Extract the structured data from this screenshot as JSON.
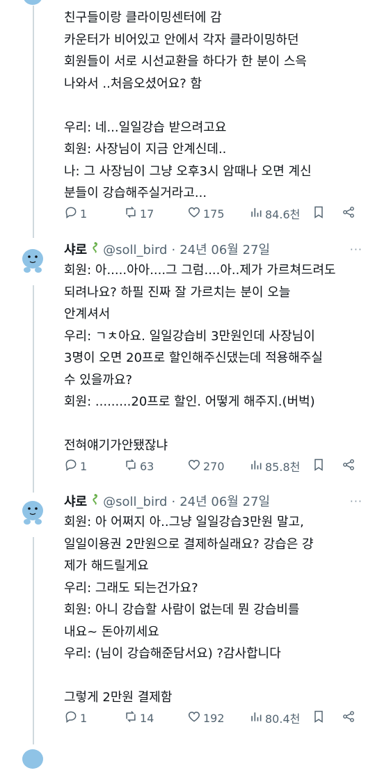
{
  "colors": {
    "text": "#0f1419",
    "muted": "#536471",
    "line": "#cfd9de",
    "avatar": "#8fc3e6"
  },
  "icons": [
    "reply-icon",
    "retweet-icon",
    "like-icon",
    "views-icon",
    "bookmark-icon",
    "share-icon",
    "more-icon",
    "dragon-emoji"
  ],
  "top_tweet": {
    "body": [
      "친구들이랑 클라이밍센터에 감",
      "카운터가 비어있고 안에서 각자 클라이밍하던",
      "회원들이 서로 시선교환을 하다가 한 분이 스윽",
      "나와서 ..처음오셨어요? 함",
      "",
      "우리: 네...일일강습 받으려고요",
      "회원: 사장님이 지금 안계신데..",
      "나: 그 사장님이 그냥 오후3시 암때나 오면 계신",
      "분들이 강습해주실거라고..."
    ],
    "stats": {
      "replies": "1",
      "reposts": "17",
      "likes": "175",
      "views": "84.6천"
    }
  },
  "tweets": [
    {
      "name": "샤로",
      "handle": "@soll_bird",
      "date": "24년 06월 27일",
      "body": [
        "회원: 아.....아아....그 그럼....아..제가 가르쳐드려도",
        "되려나요? 하필 진짜 잘 가르치는 분이 오늘",
        "안계셔서",
        "우리: ㄱㅊ아요. 일일강습비 3만원인데 사장님이",
        "3명이 오면 20프로 할인해주신댔는데 적용해주실",
        "수 있을까요?",
        "회원: .........20프로 할인. 어떻게 해주지.(버벅)",
        "",
        "전혀얘기가안됐잖냐"
      ],
      "stats": {
        "replies": "1",
        "reposts": "63",
        "likes": "270",
        "views": "85.8천"
      }
    },
    {
      "name": "샤로",
      "handle": "@soll_bird",
      "date": "24년 06월 27일",
      "body": [
        "회원: 아 어쩌지 아..그냥 일일강습3만원 말고,",
        "일일이용권 2만원으로 결제하실래요? 강습은 걍",
        "제가 해드릴게요",
        "우리: 그래도 되는건가요?",
        "회원: 아니 강습할 사람이 없는데 뭔 강습비를",
        "내요~ 돈아끼세요",
        "우리: (님이 강습해준담서요) ?감사합니다",
        "",
        "그렇게 2만원 결제함"
      ],
      "stats": {
        "replies": "1",
        "reposts": "14",
        "likes": "192",
        "views": "80.4천"
      }
    }
  ]
}
